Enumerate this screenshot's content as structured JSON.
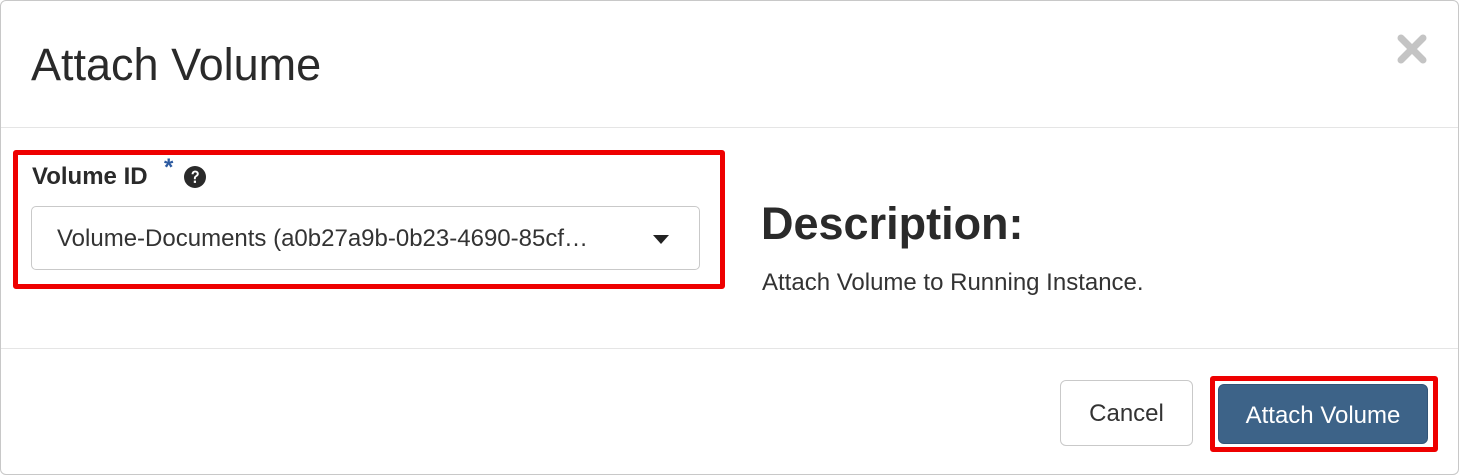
{
  "dialog": {
    "title": "Attach Volume",
    "close_icon": "close-icon"
  },
  "form": {
    "volume_id": {
      "label": "Volume ID",
      "required_marker": "*",
      "help_icon": "question-circle-icon",
      "selected_value": "Volume-Documents (a0b27a9b-0b23-4690-85cf…"
    }
  },
  "description": {
    "heading": "Description:",
    "text": "Attach Volume to Running Instance."
  },
  "footer": {
    "cancel_label": "Cancel",
    "submit_label": "Attach Volume"
  },
  "colors": {
    "primary_button": "#3d6388",
    "highlight": "#ee0000",
    "required_star": "#2c5aa0"
  }
}
